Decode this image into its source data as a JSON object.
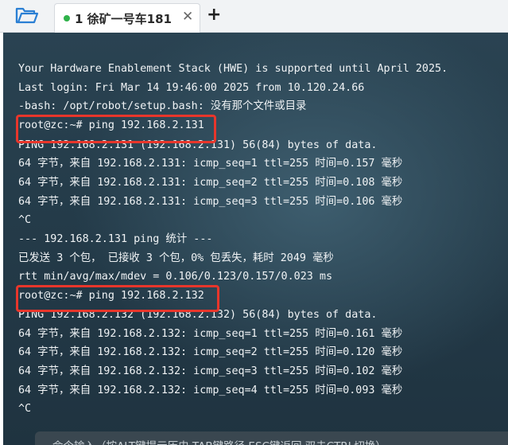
{
  "tabbar": {
    "folder_icon": "folder-open-icon",
    "tab": {
      "status_color": "#2fb24a",
      "label": "1 徐矿一号车181",
      "close_glyph": "✕"
    },
    "add_glyph": "+"
  },
  "terminal": {
    "lines": [
      "Your Hardware Enablement Stack (HWE) is supported until April 2025.",
      "Last login: Fri Mar 14 19:46:00 2025 from 10.120.24.66",
      "-bash: /opt/robot/setup.bash: 没有那个文件或目录",
      "root@zc:~# ping 192.168.2.131",
      "PING 192.168.2.131 (192.168.2.131) 56(84) bytes of data.",
      "64 字节，来自 192.168.2.131: icmp_seq=1 ttl=255 时间=0.157 毫秒",
      "64 字节，来自 192.168.2.131: icmp_seq=2 ttl=255 时间=0.108 毫秒",
      "64 字节，来自 192.168.2.131: icmp_seq=3 ttl=255 时间=0.106 毫秒",
      "^C",
      "--- 192.168.2.131 ping 统计 ---",
      "已发送 3 个包， 已接收 3 个包，0% 包丢失，耗时 2049 毫秒",
      "rtt min/avg/max/mdev = 0.106/0.123/0.157/0.023 ms",
      "root@zc:~# ping 192.168.2.132",
      "PING 192.168.2.132 (192.168.2.132) 56(84) bytes of data.",
      "64 字节，来自 192.168.2.132: icmp_seq=1 ttl=255 时间=0.161 毫秒",
      "64 字节，来自 192.168.2.132: icmp_seq=2 ttl=255 时间=0.120 毫秒",
      "64 字节，来自 192.168.2.132: icmp_seq=3 ttl=255 时间=0.102 毫秒",
      "64 字节，来自 192.168.2.132: icmp_seq=4 ttl=255 时间=0.093 毫秒",
      "^C"
    ],
    "highlight_color": "#e8362b"
  },
  "command_bar": {
    "placeholder": "命令输入（按ALT键提示历史,TAB键路径,ESC键返回,双击CTRL切换）"
  }
}
